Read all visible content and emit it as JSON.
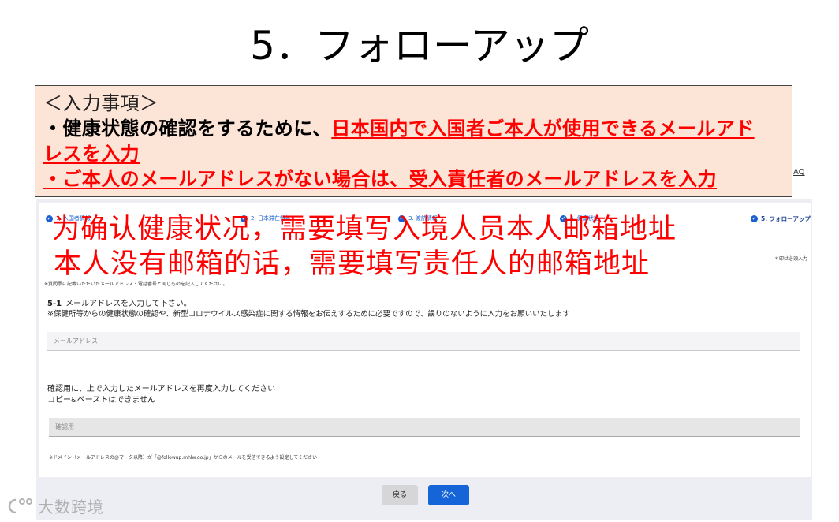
{
  "title": "5．フォローアップ",
  "notice": {
    "heading": "＜入力事項＞",
    "item1_prefix": "・健康状態の確認をするために、",
    "item1_highlight_part1": "日本国内で入国者ご本人が使用できるメールアド",
    "item1_highlight_part2": "レスを入力",
    "item2": "・ご本人のメールアドレスがない場合は、受入責任者のメールアドレスを入力"
  },
  "annotations_zh": {
    "line1": "为确认健康状况，需要填写入境人员本人邮箱地址",
    "line2": "本人没有邮箱的话，需要填写责任人的邮箱地址"
  },
  "header": {
    "faq_link": "AQ"
  },
  "steps": [
    {
      "label": "1. 入国者情報",
      "done": true
    },
    {
      "label": "2. 日本滞在情報",
      "done": true
    },
    {
      "label": "3. 渡航情報",
      "done": true
    },
    {
      "label": "4. 健康状態",
      "done": true
    },
    {
      "label": "5. フォローアップ",
      "current": true
    }
  ],
  "check_glyph": "✓",
  "required_note": "＊印は必須入力",
  "intro_line": "※質問票に記載いただいたメールアドレス・電話番号と同じものを記入してください。",
  "form": {
    "q_number": "5-1",
    "q_title": "メールアドレスを入力して下さい。",
    "q_note": "※保健所等からの健康状態の確認や、新型コロナウイルス感染症に関する情報をお伝えするために必要ですので、誤りのないように入力をお願いいたします",
    "email_placeholder": "メールアドレス",
    "confirm_line1": "確認用に、上で入力したメールアドレスを再度入力してください",
    "confirm_line2": "コピー&ペーストはできません",
    "confirm_placeholder": "確認用",
    "domain_note": "※ドメイン（メールアドレスの@マーク以降）が「@followup.mhlw.go.jp」からのメールを受信できるよう設定してください"
  },
  "buttons": {
    "back": "戻る",
    "next": "次へ"
  },
  "watermark": "大数跨境",
  "colors": {
    "notice_bg": "#fce4d6",
    "highlight_red": "#ff0000",
    "primary_blue": "#1565d8",
    "back_button_gray": "#d6d6d8"
  }
}
